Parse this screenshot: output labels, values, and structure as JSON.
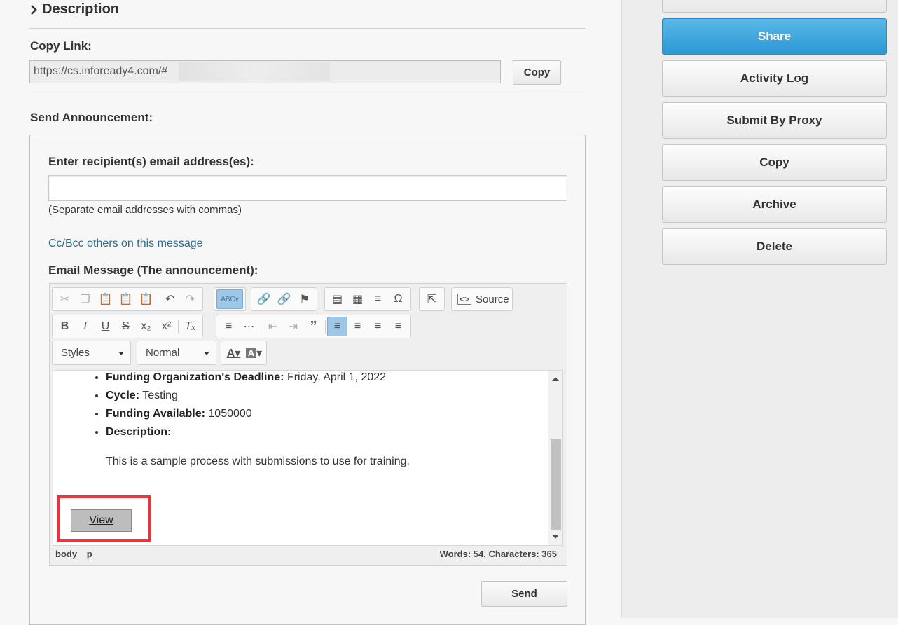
{
  "description": {
    "title": "Description"
  },
  "copy_link": {
    "label": "Copy Link:",
    "value": "https://cs.infoready4.com/#",
    "copy_button": "Copy"
  },
  "announcement": {
    "label": "Send Announcement:",
    "recipients_label": "Enter recipient(s) email address(es):",
    "recipients_value": "",
    "recipients_hint": "(Separate email addresses with commas)",
    "cc_link": "Cc/Bcc others on this message",
    "message_label": "Email Message (The announcement):",
    "send_button": "Send"
  },
  "editor": {
    "source_label": "Source",
    "styles_combo": "Styles",
    "format_combo": "Normal",
    "items": [
      {
        "label": "Funding Organization's Deadline:",
        "value": "Friday, April 1, 2022"
      },
      {
        "label": "Cycle:",
        "value": "Testing"
      },
      {
        "label": "Funding Available:",
        "value": "1050000"
      },
      {
        "label": "Description:",
        "value": ""
      }
    ],
    "paragraph": "This is a sample process with submissions to use for training.",
    "view_button": "View",
    "path": [
      "body",
      "p"
    ],
    "word_count": "Words: 54, Characters: 365",
    "active_color": "#9ec6e6"
  },
  "sidebar": {
    "buttons": [
      {
        "label": "Share",
        "primary": true
      },
      {
        "label": "Activity Log"
      },
      {
        "label": "Submit By Proxy"
      },
      {
        "label": "Copy"
      },
      {
        "label": "Archive"
      },
      {
        "label": "Delete"
      }
    ],
    "primary_color": "#2b98d4"
  },
  "highlight_color": "#e8343a"
}
